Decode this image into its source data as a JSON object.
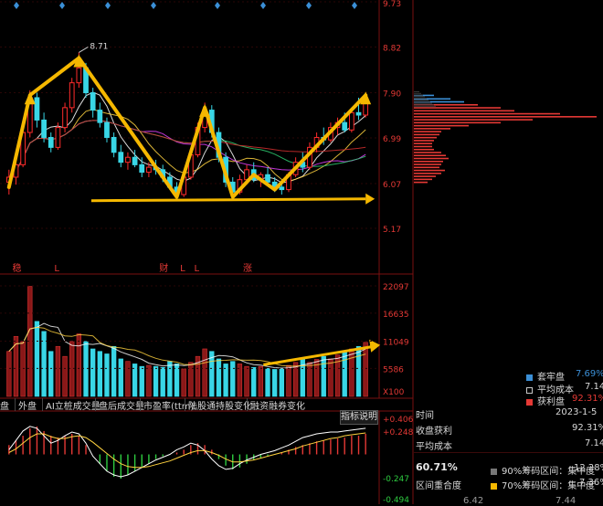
{
  "top_diamonds": 8,
  "price_axis": {
    "ticks": [
      "9.73",
      "8.82",
      "7.90",
      "6.99",
      "6.07",
      "5.17"
    ]
  },
  "peak_annotation": "8.71",
  "markers": [
    "稳",
    "L",
    "财",
    "L",
    "L",
    "涨"
  ],
  "volume_axis": {
    "ticks": [
      "22097",
      "16635",
      "11049",
      "5586"
    ],
    "unit": "X100"
  },
  "tabs": [
    "盘",
    "外盘",
    "AI立桩成交量",
    "盘后成交量",
    "市盈率(ttm)",
    "陆股通持股变化",
    "融资融券变化"
  ],
  "indicator_button": "指标说明",
  "macd_axis": {
    "ticks": [
      "+0.406",
      "+0.248",
      "-0.247",
      "-0.494"
    ]
  },
  "panel": {
    "legend": [
      {
        "label": "套牢盘",
        "value": "7.69%",
        "color": "#3b8fd6"
      },
      {
        "label": "平均成本",
        "value": "7.14",
        "color": "#c8c8c8"
      },
      {
        "label": "获利盘",
        "value": "92.31%",
        "color": "#e53935"
      }
    ],
    "rows": [
      {
        "label": "时间",
        "value": "2023-1-5"
      },
      {
        "label": "收盘获利",
        "value": "92.31%"
      },
      {
        "label": "平均成本",
        "value": "7.14"
      }
    ],
    "concentration": {
      "big_value": "60.71%",
      "sub_label": "区间重合度",
      "row90": {
        "label": "90%筹码区间：集中度",
        "value": "12.28%",
        "color": "#777777"
      },
      "row70": {
        "label": "70%筹码区间：集中度",
        "value": "7.36%",
        "color": "#f5b800"
      }
    },
    "bottom_ticks": [
      "6.42",
      "7.44"
    ]
  },
  "chart_data": [
    {
      "type": "candlestick",
      "ylim": [
        5.17,
        9.73
      ],
      "peak_label": "8.71",
      "candles": [
        {
          "o": 6.1,
          "h": 6.35,
          "l": 5.85,
          "c": 6.2
        },
        {
          "o": 6.2,
          "h": 6.6,
          "l": 6.05,
          "c": 6.45
        },
        {
          "o": 6.45,
          "h": 7.2,
          "l": 6.4,
          "c": 7.1
        },
        {
          "o": 7.1,
          "h": 7.95,
          "l": 7.0,
          "c": 7.8
        },
        {
          "o": 7.8,
          "h": 7.9,
          "l": 7.2,
          "c": 7.35
        },
        {
          "o": 7.35,
          "h": 7.5,
          "l": 6.9,
          "c": 7.0
        },
        {
          "o": 7.0,
          "h": 7.1,
          "l": 6.7,
          "c": 6.8
        },
        {
          "o": 6.8,
          "h": 7.3,
          "l": 6.75,
          "c": 7.2
        },
        {
          "o": 7.2,
          "h": 7.7,
          "l": 7.1,
          "c": 7.6
        },
        {
          "o": 7.6,
          "h": 8.2,
          "l": 7.5,
          "c": 8.1
        },
        {
          "o": 8.1,
          "h": 8.71,
          "l": 8.0,
          "c": 8.4
        },
        {
          "o": 8.4,
          "h": 8.5,
          "l": 7.8,
          "c": 7.9
        },
        {
          "o": 7.9,
          "h": 8.0,
          "l": 7.4,
          "c": 7.55
        },
        {
          "o": 7.55,
          "h": 7.7,
          "l": 7.2,
          "c": 7.3
        },
        {
          "o": 7.3,
          "h": 7.4,
          "l": 6.9,
          "c": 7.0
        },
        {
          "o": 7.0,
          "h": 7.1,
          "l": 6.6,
          "c": 6.7
        },
        {
          "o": 6.7,
          "h": 6.85,
          "l": 6.4,
          "c": 6.5
        },
        {
          "o": 6.5,
          "h": 6.7,
          "l": 6.35,
          "c": 6.6
        },
        {
          "o": 6.6,
          "h": 6.75,
          "l": 6.4,
          "c": 6.45
        },
        {
          "o": 6.45,
          "h": 6.6,
          "l": 6.2,
          "c": 6.3
        },
        {
          "o": 6.3,
          "h": 6.5,
          "l": 6.2,
          "c": 6.4
        },
        {
          "o": 6.4,
          "h": 6.55,
          "l": 6.25,
          "c": 6.35
        },
        {
          "o": 6.35,
          "h": 6.45,
          "l": 6.1,
          "c": 6.2
        },
        {
          "o": 6.2,
          "h": 6.3,
          "l": 5.95,
          "c": 6.0
        },
        {
          "o": 6.0,
          "h": 6.1,
          "l": 5.75,
          "c": 5.85
        },
        {
          "o": 5.85,
          "h": 6.3,
          "l": 5.8,
          "c": 6.2
        },
        {
          "o": 6.2,
          "h": 6.75,
          "l": 6.15,
          "c": 6.65
        },
        {
          "o": 6.65,
          "h": 7.3,
          "l": 6.6,
          "c": 7.2
        },
        {
          "o": 7.2,
          "h": 7.7,
          "l": 7.1,
          "c": 7.55
        },
        {
          "o": 7.55,
          "h": 7.65,
          "l": 7.0,
          "c": 7.1
        },
        {
          "o": 7.1,
          "h": 7.2,
          "l": 6.5,
          "c": 6.6
        },
        {
          "o": 6.6,
          "h": 6.7,
          "l": 6.0,
          "c": 6.1
        },
        {
          "o": 6.1,
          "h": 6.2,
          "l": 5.8,
          "c": 5.9
        },
        {
          "o": 5.9,
          "h": 6.25,
          "l": 5.85,
          "c": 6.15
        },
        {
          "o": 6.15,
          "h": 6.45,
          "l": 6.05,
          "c": 6.35
        },
        {
          "o": 6.35,
          "h": 6.5,
          "l": 6.1,
          "c": 6.15
        },
        {
          "o": 6.15,
          "h": 6.3,
          "l": 6.0,
          "c": 6.25
        },
        {
          "o": 6.25,
          "h": 6.4,
          "l": 6.05,
          "c": 6.1
        },
        {
          "o": 6.1,
          "h": 6.2,
          "l": 5.9,
          "c": 6.0
        },
        {
          "o": 6.0,
          "h": 6.1,
          "l": 5.85,
          "c": 5.95
        },
        {
          "o": 5.95,
          "h": 6.3,
          "l": 5.9,
          "c": 6.25
        },
        {
          "o": 6.25,
          "h": 6.6,
          "l": 6.2,
          "c": 6.5
        },
        {
          "o": 6.5,
          "h": 6.7,
          "l": 6.3,
          "c": 6.4
        },
        {
          "o": 6.4,
          "h": 6.9,
          "l": 6.35,
          "c": 6.8
        },
        {
          "o": 6.8,
          "h": 7.1,
          "l": 6.7,
          "c": 7.0
        },
        {
          "o": 7.0,
          "h": 7.2,
          "l": 6.85,
          "c": 6.95
        },
        {
          "o": 6.95,
          "h": 7.3,
          "l": 6.9,
          "c": 7.2
        },
        {
          "o": 7.2,
          "h": 7.4,
          "l": 7.05,
          "c": 7.3
        },
        {
          "o": 7.3,
          "h": 7.5,
          "l": 7.1,
          "c": 7.15
        },
        {
          "o": 7.15,
          "h": 7.6,
          "l": 7.1,
          "c": 7.5
        },
        {
          "o": 7.5,
          "h": 7.8,
          "l": 7.35,
          "c": 7.45
        },
        {
          "o": 7.45,
          "h": 7.9,
          "l": 7.4,
          "c": 7.8
        }
      ],
      "ma_series": [
        {
          "color": "#ffffff",
          "period": 5
        },
        {
          "color": "#ffd23f",
          "period": 10
        },
        {
          "color": "#e040fb",
          "period": 20
        },
        {
          "color": "#2ecc71",
          "period": 30
        },
        {
          "color": "#d32f2f",
          "period": 60
        }
      ],
      "trend_polyline": [
        [
          0,
          6.0
        ],
        [
          3,
          7.85
        ],
        [
          10,
          8.6
        ],
        [
          24,
          5.8
        ],
        [
          28,
          7.6
        ],
        [
          32,
          5.8
        ],
        [
          35,
          6.25
        ],
        [
          38,
          5.95
        ],
        [
          51,
          7.85
        ]
      ],
      "support_line": [
        [
          17,
          5.8
        ],
        [
          51,
          5.8
        ]
      ]
    },
    {
      "type": "bar",
      "title": "volume",
      "ylim": [
        0,
        22097
      ],
      "values": [
        9000,
        12000,
        11000,
        22000,
        15000,
        13000,
        9000,
        10000,
        8000,
        11000,
        12500,
        11000,
        9500,
        9000,
        8500,
        10000,
        7500,
        7000,
        6500,
        6000,
        6200,
        6000,
        5800,
        7000,
        6500,
        5500,
        6800,
        8000,
        9500,
        9000,
        7500,
        6500,
        7000,
        6500,
        6000,
        5800,
        6000,
        5600,
        5400,
        5500,
        6200,
        6800,
        7500,
        6800,
        7400,
        8000,
        7500,
        8300,
        8800,
        9500,
        10000,
        10800
      ],
      "trend_arrow": [
        [
          39,
          5600
        ],
        [
          51,
          11000
        ]
      ]
    },
    {
      "type": "bar",
      "title": "macd",
      "ylim": [
        -0.494,
        0.406
      ],
      "values": [
        0.1,
        0.15,
        0.2,
        0.28,
        0.3,
        0.25,
        0.2,
        0.18,
        0.2,
        0.22,
        0.2,
        0.1,
        0.0,
        -0.1,
        -0.18,
        -0.24,
        -0.26,
        -0.22,
        -0.18,
        -0.14,
        -0.1,
        -0.05,
        -0.02,
        0.0,
        0.02,
        0.05,
        0.1,
        0.12,
        0.1,
        0.05,
        -0.05,
        -0.12,
        -0.16,
        -0.14,
        -0.1,
        -0.06,
        -0.04,
        -0.02,
        0.0,
        0.02,
        0.05,
        0.08,
        0.1,
        0.12,
        0.14,
        0.15,
        0.16,
        0.17,
        0.18,
        0.2,
        0.2,
        0.22
      ],
      "dif": [
        0.05,
        0.15,
        0.25,
        0.3,
        0.28,
        0.2,
        0.12,
        0.15,
        0.2,
        0.24,
        0.22,
        0.12,
        -0.02,
        -0.1,
        -0.18,
        -0.22,
        -0.24,
        -0.22,
        -0.18,
        -0.14,
        -0.1,
        -0.06,
        -0.03,
        0.0,
        0.05,
        0.08,
        0.12,
        0.1,
        0.04,
        -0.05,
        -0.12,
        -0.16,
        -0.15,
        -0.1,
        -0.06,
        -0.03,
        0.0,
        0.02,
        0.04,
        0.07,
        0.1,
        0.14,
        0.18,
        0.2,
        0.22,
        0.23,
        0.24,
        0.24,
        0.25,
        0.26,
        0.27,
        0.28
      ],
      "dea": [
        0.02,
        0.06,
        0.12,
        0.18,
        0.22,
        0.22,
        0.19,
        0.17,
        0.17,
        0.19,
        0.2,
        0.18,
        0.13,
        0.07,
        0.01,
        -0.05,
        -0.1,
        -0.13,
        -0.14,
        -0.14,
        -0.13,
        -0.11,
        -0.09,
        -0.07,
        -0.04,
        -0.01,
        0.02,
        0.04,
        0.04,
        0.02,
        -0.01,
        -0.05,
        -0.08,
        -0.08,
        -0.07,
        -0.06,
        -0.04,
        -0.02,
        0.0,
        0.02,
        0.04,
        0.06,
        0.09,
        0.11,
        0.13,
        0.15,
        0.17,
        0.18,
        0.2,
        0.21,
        0.22,
        0.23
      ]
    },
    {
      "type": "bar",
      "title": "chip-distribution",
      "orientation": "horizontal",
      "levels": [
        7.85,
        7.78,
        7.72,
        7.66,
        7.6,
        7.54,
        7.48,
        7.42,
        7.36,
        7.3,
        7.24,
        7.18,
        7.12,
        7.06,
        7.0,
        6.94,
        6.88,
        6.82,
        6.76,
        6.7,
        6.64,
        6.58,
        6.52,
        6.46,
        6.4,
        6.34,
        6.28,
        6.22,
        6.16,
        6.1
      ],
      "values": [
        22,
        40,
        55,
        70,
        95,
        110,
        160,
        200,
        130,
        95,
        60,
        40,
        30,
        28,
        25,
        22,
        20,
        20,
        22,
        30,
        35,
        38,
        32,
        30,
        28,
        34,
        30,
        24,
        20,
        15
      ],
      "profit_split": 7.66
    }
  ]
}
